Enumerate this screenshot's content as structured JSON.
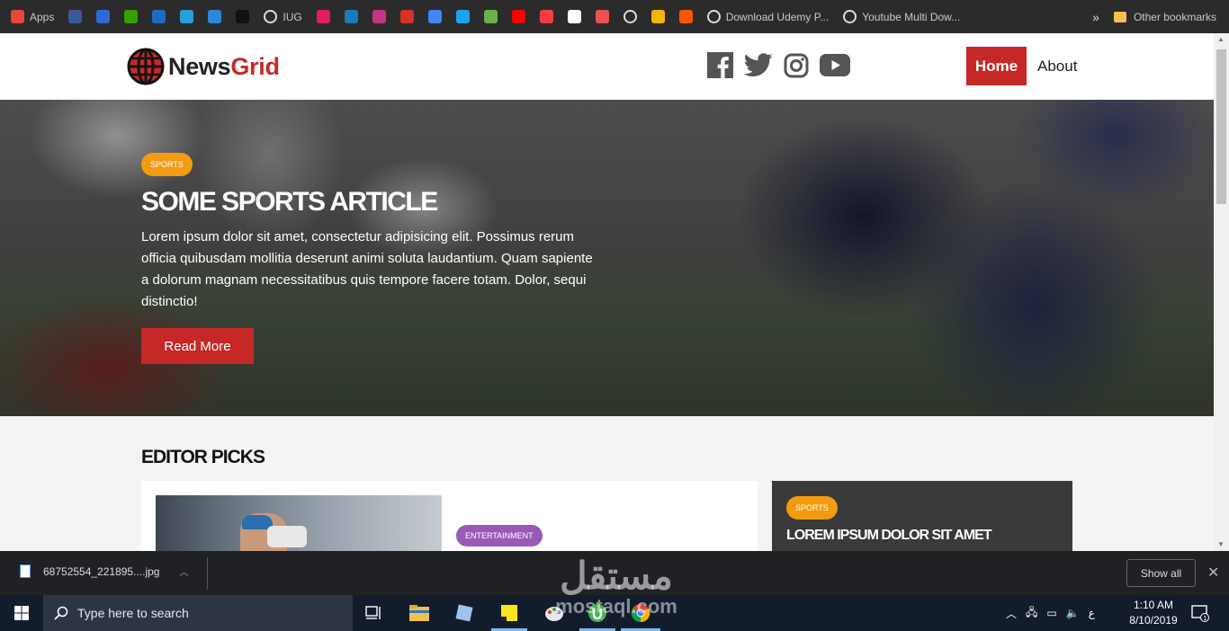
{
  "browser": {
    "bookmarks": [
      {
        "label": "Apps",
        "icon": "apps-grid-icon",
        "color": "#e8453c"
      },
      {
        "label": "",
        "icon": "facebook-icon",
        "color": "#3b5998"
      },
      {
        "label": "",
        "icon": "compass-icon",
        "color": "#2d6ad8"
      },
      {
        "label": "",
        "icon": "upwork-icon",
        "color": "#37a000"
      },
      {
        "label": "",
        "icon": "paypal-icon",
        "color": "#1f6bc1"
      },
      {
        "label": "",
        "icon": "photo-icon",
        "color": "#26a0da"
      },
      {
        "label": "",
        "icon": "yammer-icon",
        "color": "#2b88d8"
      },
      {
        "label": "",
        "icon": "github-icon",
        "color": "#111111"
      },
      {
        "label": "IUG",
        "icon": "globe-icon",
        "color": "#dddddd"
      },
      {
        "label": "",
        "icon": "slack-icon",
        "color": "#e01e5a"
      },
      {
        "label": "",
        "icon": "scribd-icon",
        "color": "#1a7bba"
      },
      {
        "label": "",
        "icon": "instagram-icon",
        "color": "#c13584"
      },
      {
        "label": "",
        "icon": "gmail-icon",
        "color": "#d93025"
      },
      {
        "label": "",
        "icon": "translate-icon",
        "color": "#4285f4"
      },
      {
        "label": "",
        "icon": "twitter-icon",
        "color": "#1da1f2"
      },
      {
        "label": "",
        "icon": "download-icon",
        "color": "#6ab04c"
      },
      {
        "label": "",
        "icon": "youtube-icon",
        "color": "#ff0000"
      },
      {
        "label": "",
        "icon": "music-icon",
        "color": "#fc3c44"
      },
      {
        "label": "",
        "icon": "r-icon",
        "color": "#ffffff"
      },
      {
        "label": "",
        "icon": "udemy-icon",
        "color": "#ec5252"
      },
      {
        "label": "",
        "icon": "globe-icon",
        "color": "#dddddd"
      },
      {
        "label": "",
        "icon": "drive-icon",
        "color": "#f4b400"
      },
      {
        "label": "",
        "icon": "soundcloud-icon",
        "color": "#ff5500"
      },
      {
        "label": "Download Udemy P...",
        "icon": "globe-icon",
        "color": "#dddddd"
      },
      {
        "label": "Youtube Multi Dow...",
        "icon": "globe-icon",
        "color": "#dddddd"
      }
    ],
    "overflow": "»",
    "other_bookmarks": "Other bookmarks"
  },
  "site": {
    "logo_main": "News",
    "logo_accent": "Grid",
    "social": [
      "facebook",
      "twitter",
      "instagram",
      "youtube"
    ],
    "nav": {
      "home": "Home",
      "about": "About"
    },
    "accent_color": "#c62828"
  },
  "hero": {
    "tag": "SPORTS",
    "title": "Some Sports Article",
    "text": "Lorem ipsum dolor sit amet, consectetur adipisicing elit. Possimus rerum officia quibusdam mollitia deserunt animi soluta laudantium. Quam sapiente a dolorum magnam necessitatibus quis tempore facere totam. Dolor, sequi distinctio!",
    "button": "Read More"
  },
  "editor_picks": {
    "heading": "Editor Picks",
    "main_card": {
      "tag": "ENTERTAINMENT"
    },
    "side_card": {
      "tag": "SPORTS",
      "title": "Lorem ipsum dolor sit amet"
    }
  },
  "downloads": {
    "file": "68752554_221895....jpg",
    "show_all": "Show all",
    "close": "✕"
  },
  "watermark": {
    "arabic": "مستقل",
    "latin": "mostaql.com"
  },
  "taskbar": {
    "search_placeholder": "Type here to search",
    "lang": "ع",
    "time": "1:10 AM",
    "date": "8/10/2019",
    "notifications": "1"
  }
}
